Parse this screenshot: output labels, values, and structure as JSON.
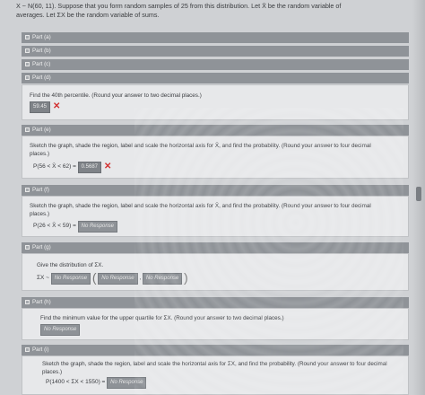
{
  "intro": {
    "line1": "X ~ N(60, 11). Suppose that you form random samples of 25 from this distribution. Let X̄ be the random variable of",
    "line2": "averages. Let ΣX be the random variable of sums."
  },
  "parts": {
    "a": "Part (a)",
    "b": "Part (b)",
    "c": "Part (c)",
    "d": "Part (d)",
    "e": "Part (e)",
    "f": "Part (f)",
    "g": "Part (g)",
    "h": "Part (h)",
    "i": "Part (i)"
  },
  "part_d": {
    "question": "Find the 40th percentile. (Round your answer to two decimal places.)",
    "answer": "59.45"
  },
  "part_e": {
    "question_line1": "Sketch the graph, shade the region, label and scale the horizontal axis for X̄, and find the probability. (Round your answer to four decimal",
    "question_line2": "places.)",
    "expr": "P(56 < X̄ < 62) =",
    "answer": "0.5687"
  },
  "part_f": {
    "question_line1": "Sketch the graph, shade the region, label and scale the horizontal axis for X̄, and find the probability. (Round your answer to four decimal",
    "question_line2": "places.)",
    "expr": "P(26 < X̄ < 59) =",
    "answer": "No Response"
  },
  "part_g": {
    "question": "Give the distribution of ΣX.",
    "expr": "ΣX ~",
    "answer1": "No Response",
    "answer2": "No Response",
    "answer3": "No Response"
  },
  "part_h": {
    "question": "Find the minimum value for the upper quartile for ΣX. (Round your answer to two decimal places.)",
    "answer": "No Response"
  },
  "part_i": {
    "question_line1": "Sketch the graph, shade the region, label and scale the horizontal axis for ΣX, and find the probability. (Round your answer to four decimal",
    "question_line2": "places.)",
    "expr": "P(1400 < ΣX < 1550) =",
    "answer": "No Response"
  },
  "colors": {
    "wrong_mark": "#d23131",
    "bar": "#8f9398",
    "panel": "#e7e8ea"
  },
  "icons": {
    "part_toggle": "square-box-icon",
    "wrong": "x-mark-icon"
  }
}
